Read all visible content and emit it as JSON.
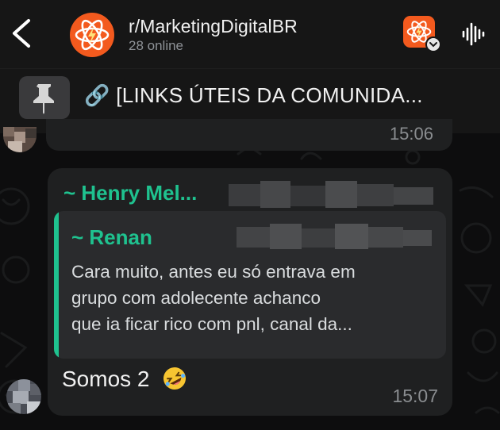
{
  "header": {
    "back_icon": "chevron-left-icon",
    "group_avatar_icon": "atom-lightning-icon",
    "title": "r/MarketingDigitalBR",
    "subtitle": "28 online",
    "subreddit_icon": "atom-lightning-icon",
    "voice_chat_icon": "waveform-icon"
  },
  "pinned": {
    "icon": "pin-icon",
    "text": "🔗 [LINKS ÚTEIS DA COMUNIDA..."
  },
  "previous_message": {
    "time": "15:06"
  },
  "message": {
    "sender": "~ Henry Mel...",
    "quote": {
      "sender": "~ Renan",
      "lines": [
        "Cara muito, antes eu só entrava em",
        "grupo com adolecente achanco",
        "que ia ficar rico com pnl, canal da..."
      ]
    },
    "text": "Somos 2",
    "emoji": "rolling-on-floor-laughing-emoji",
    "time": "15:07"
  },
  "colors": {
    "accent_green": "#1fc28f",
    "brand_orange": "#f35a1e",
    "bubble": "#1f2021",
    "header": "#161616"
  }
}
